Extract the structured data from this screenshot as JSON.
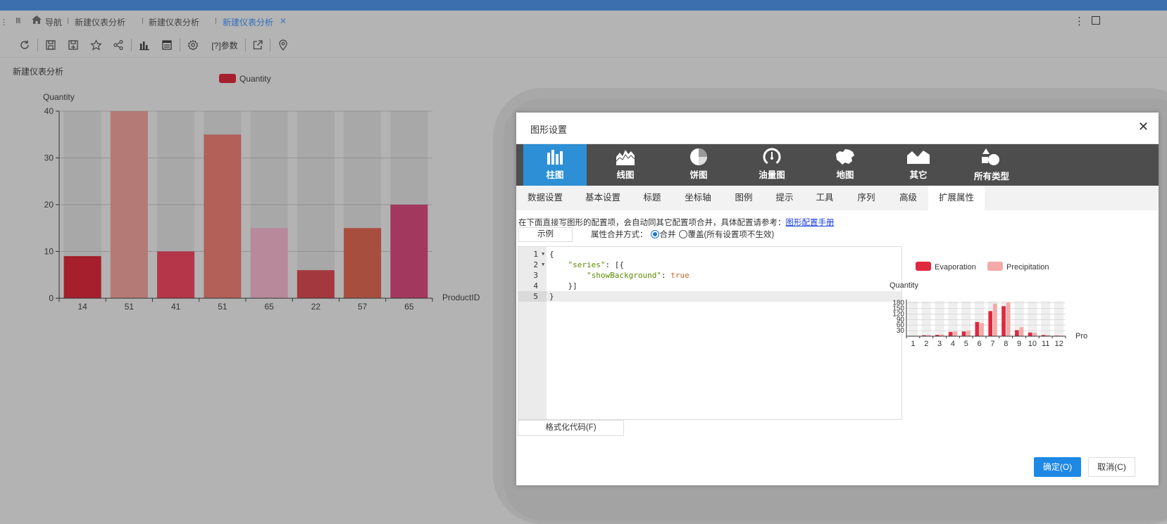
{
  "tabs": {
    "nav_label": "导航",
    "items": [
      "新建仪表分析",
      "新建仪表分析",
      "新建仪表分析"
    ]
  },
  "toolbar": {
    "param_label": "[?]参数"
  },
  "dashboard": {
    "title": "新建仪表分析"
  },
  "chart_data": [
    {
      "type": "bar",
      "legend": [
        "Quantity"
      ],
      "ylabel": "Quantity",
      "xlabel": "ProductID",
      "categories": [
        "14",
        "51",
        "41",
        "51",
        "65",
        "22",
        "57",
        "65"
      ],
      "values": [
        9,
        40,
        10,
        35,
        15,
        6,
        15,
        20
      ],
      "ylim": [
        0,
        40
      ],
      "yticks": [
        0,
        10,
        20,
        30,
        40
      ],
      "show_background": true,
      "colors": [
        "#a61f2c",
        "#b47a76",
        "#b53549",
        "#b26058",
        "#b8899a",
        "#a4383f",
        "#a84e3f",
        "#a3385e"
      ],
      "background_color": "#a8a8a8",
      "legend_color": "#a61f2c"
    },
    {
      "type": "bar",
      "legend": [
        "Evaporation",
        "Precipitation"
      ],
      "ylabel": "Quantity",
      "xlabel": "Pro",
      "categories": [
        "1",
        "2",
        "3",
        "4",
        "5",
        "6",
        "7",
        "8",
        "9",
        "10",
        "11",
        "12"
      ],
      "series": [
        {
          "name": "Evaporation",
          "values": [
            2.0,
            4.9,
            7.0,
            23.2,
            25.6,
            76.7,
            135.6,
            162.2,
            32.6,
            20.0,
            6.4,
            3.3
          ]
        },
        {
          "name": "Precipitation",
          "values": [
            2.6,
            5.9,
            9.0,
            26.4,
            28.7,
            70.7,
            175.6,
            182.2,
            48.7,
            18.8,
            6.0,
            2.3
          ]
        }
      ],
      "yticks": [
        30,
        60,
        90,
        120,
        150,
        180
      ],
      "ylim": [
        0,
        190
      ],
      "show_background": true,
      "colors": [
        "#e0283f",
        "#f4aaa8"
      ]
    }
  ],
  "modal": {
    "title": "图形设置",
    "chart_types": [
      {
        "label": "柱图",
        "icon": "bar-chart-icon",
        "active": true
      },
      {
        "label": "线图",
        "icon": "line-chart-icon",
        "active": false
      },
      {
        "label": "饼图",
        "icon": "pie-chart-icon",
        "active": false
      },
      {
        "label": "油量图",
        "icon": "gauge-chart-icon",
        "active": false
      },
      {
        "label": "地图",
        "icon": "map-chart-icon",
        "active": false
      },
      {
        "label": "其它",
        "icon": "other-chart-icon",
        "active": false
      },
      {
        "label": "所有类型",
        "icon": "all-types-icon",
        "active": false
      }
    ],
    "subtabs": [
      {
        "label": "数据设置",
        "active": false
      },
      {
        "label": "基本设置",
        "active": false
      },
      {
        "label": "标题",
        "active": false
      },
      {
        "label": "坐标轴",
        "active": false
      },
      {
        "label": "图例",
        "active": false
      },
      {
        "label": "提示",
        "active": false
      },
      {
        "label": "工具",
        "active": false
      },
      {
        "label": "序列",
        "active": false
      },
      {
        "label": "高级",
        "active": false
      },
      {
        "label": "扩展属性",
        "active": true
      }
    ],
    "hint_text": "在下面直接写图形的配置项，会自动同其它配置项合并，具体配置请参考：",
    "hint_link": "图形配置手册",
    "example_button": "示例",
    "merge_label": "属性合并方式：",
    "merge_option": "合并",
    "override_option": "覆盖(所有设置项不生效)",
    "merge_selected": "合并",
    "code_lines": [
      {
        "num": "1",
        "fold": true,
        "text": "{"
      },
      {
        "num": "2",
        "fold": true,
        "text": "    \"series\": [{"
      },
      {
        "num": "3",
        "fold": false,
        "text": "        \"showBackground\": true"
      },
      {
        "num": "4",
        "fold": false,
        "text": "    }]"
      },
      {
        "num": "5",
        "fold": false,
        "text": "}"
      }
    ],
    "current_line": 5,
    "format_button": "格式化代码(F)",
    "ok_button": "确定(O)",
    "cancel_button": "取消(C)"
  }
}
